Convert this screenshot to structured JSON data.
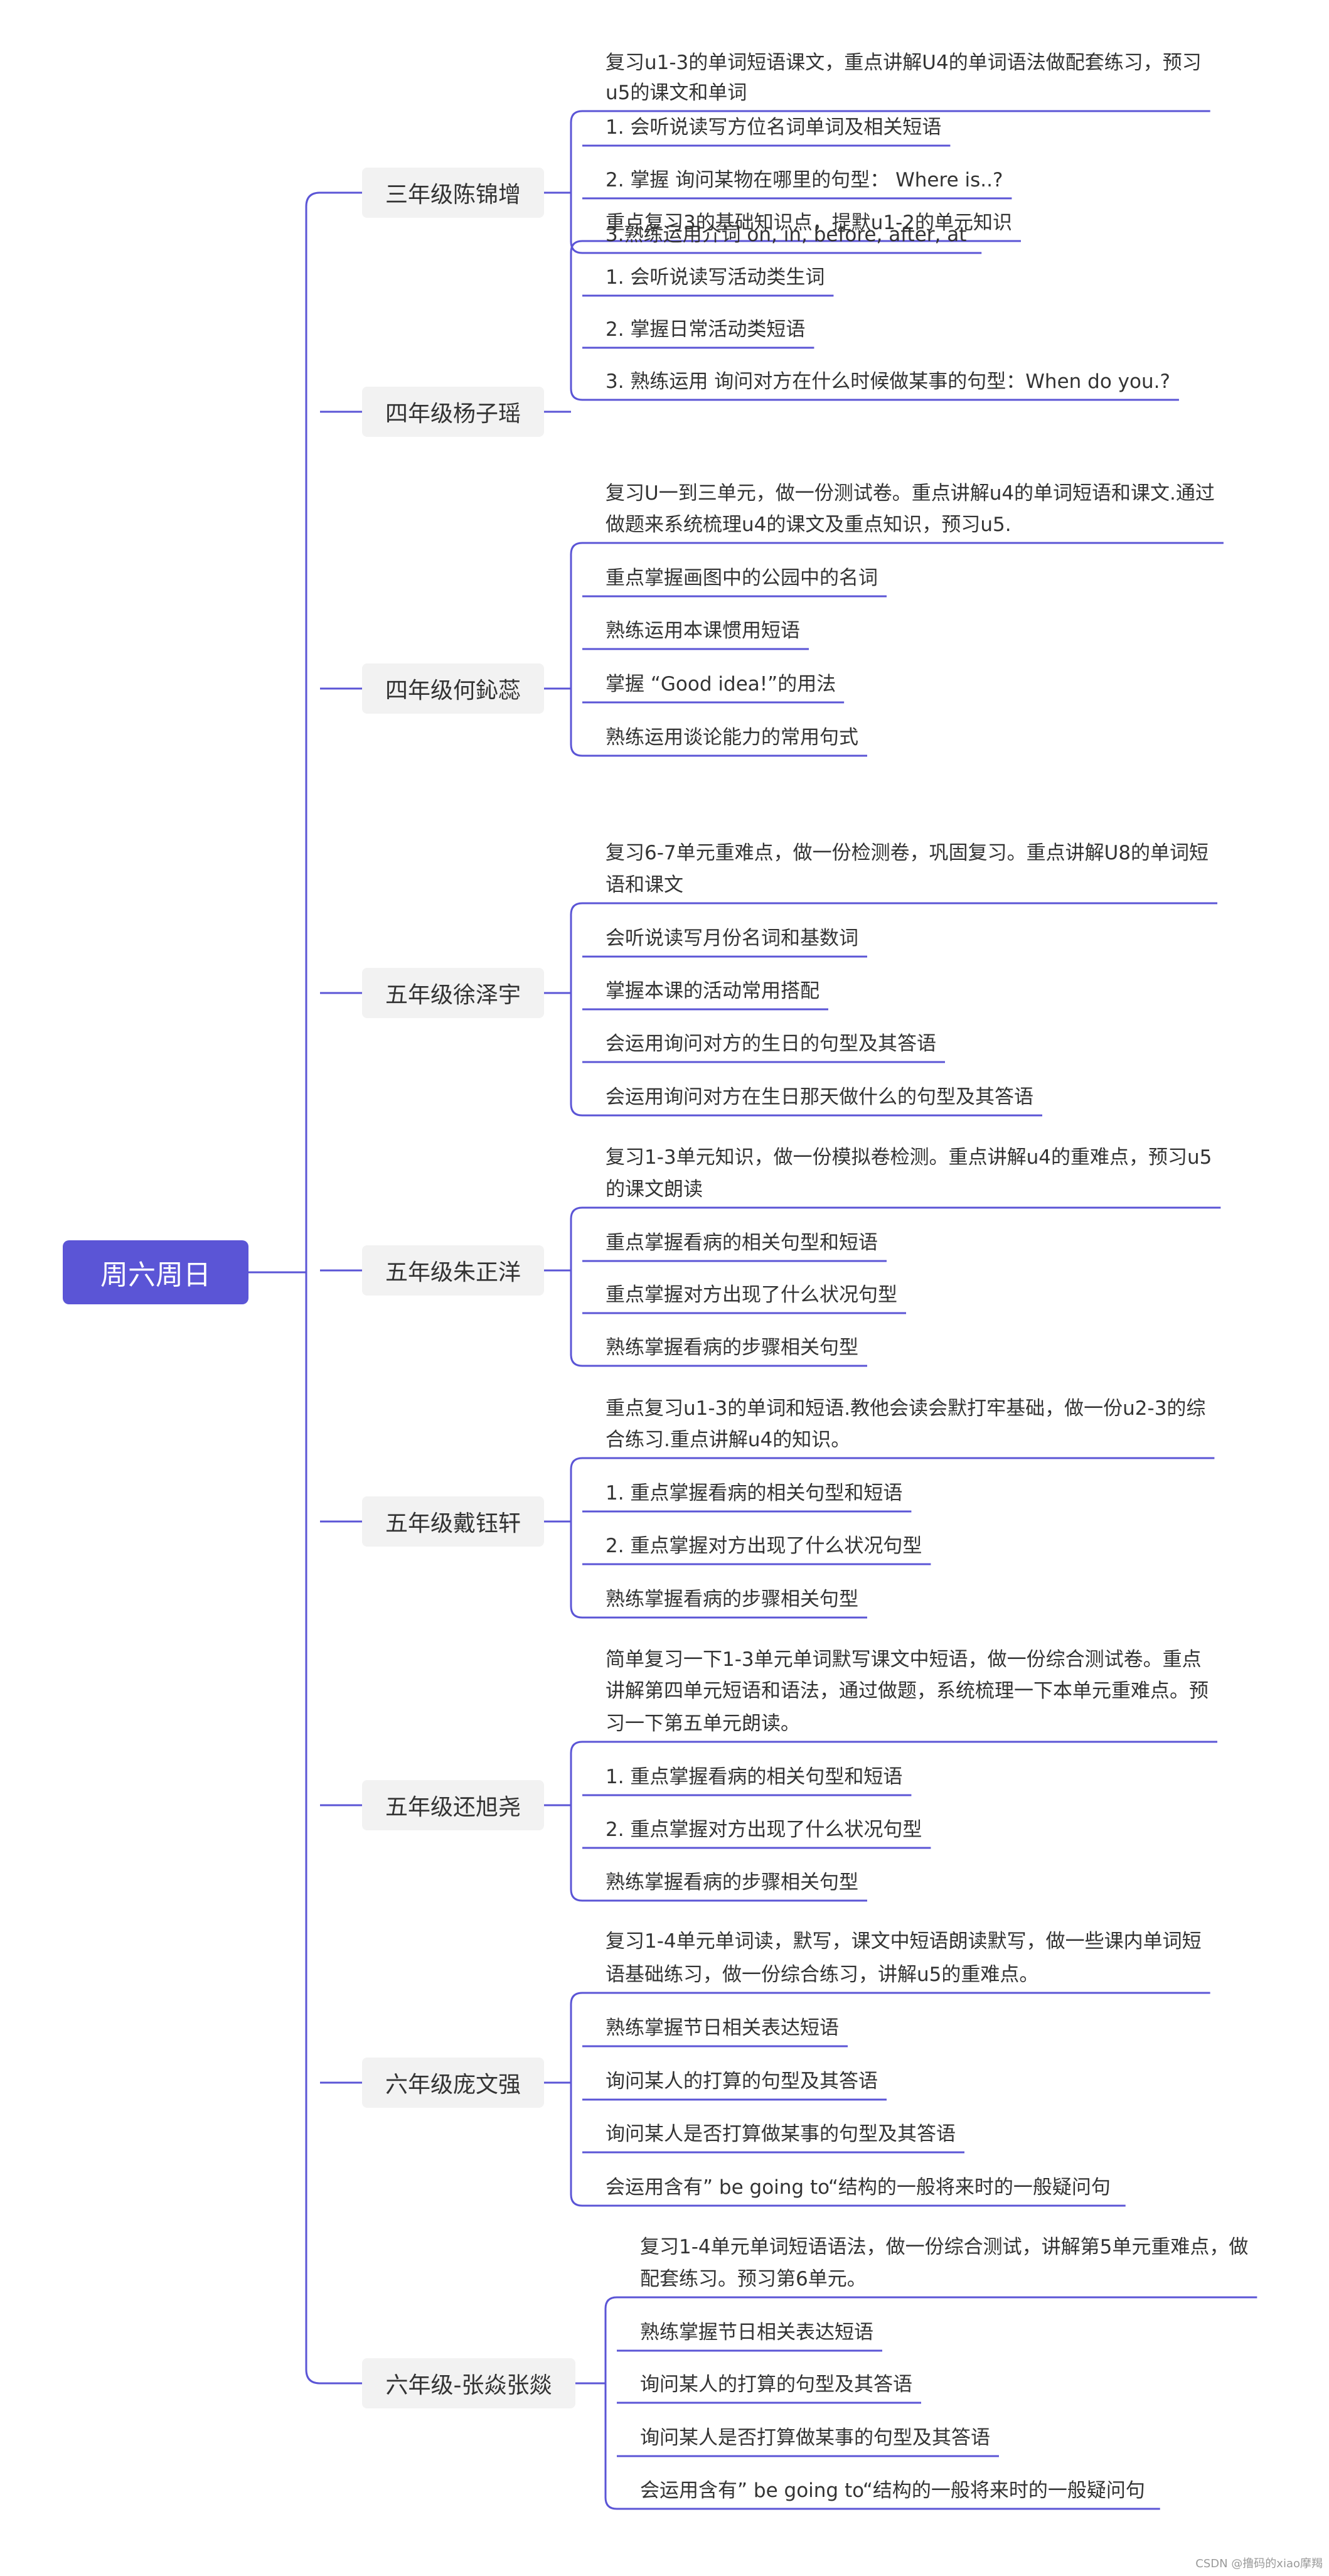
{
  "root": {
    "label": "周六周日"
  },
  "branches": [
    {
      "label": "三年级陈锦增",
      "leaves": [
        [
          "复习u1-3的单词短语课文，重点讲解U4的单词语法做配套练习，预习",
          "u5的课文和单词"
        ],
        [
          "1. 会听说读写方位名词单词及相关短语"
        ],
        [
          "2. 掌握 询问某物在哪里的句型： Where is..?"
        ],
        [
          "3.熟练运用介词  on, in, before, after, at"
        ]
      ]
    },
    {
      "label": "四年级杨子瑶",
      "leaves": [
        [
          "重点复习3的基础知识点，提默u1-2的单元知识"
        ],
        [
          "1. 会听说读写活动类生词"
        ],
        [
          "2. 掌握日常活动类短语"
        ],
        [
          "3. 熟练运用 询问对方在什么时候做某事的句型：When do you.?"
        ]
      ]
    },
    {
      "label": "四年级何鈊蕊",
      "leaves": [
        [
          "复习U一到三单元，做一份测试卷。重点讲解u4的单词短语和课文.通过",
          "做题来系统梳理u4的课文及重点知识，预习u5."
        ],
        [
          "重点掌握画图中的公园中的名词"
        ],
        [
          "熟练运用本课惯用短语"
        ],
        [
          "掌握 “Good idea!”的用法"
        ],
        [
          "熟练运用谈论能力的常用句式"
        ]
      ]
    },
    {
      "label": "五年级徐泽宇",
      "leaves": [
        [
          "复习6-7单元重难点，做一份检测卷，巩固复习。重点讲解U8的单词短",
          "语和课文"
        ],
        [
          "会听说读写月份名词和基数词"
        ],
        [
          "掌握本课的活动常用搭配"
        ],
        [
          "会运用询问对方的生日的句型及其答语"
        ],
        [
          "会运用询问对方在生日那天做什么的句型及其答语"
        ]
      ]
    },
    {
      "label": "五年级朱正洋",
      "leaves": [
        [
          "复习1-3单元知识，做一份模拟卷检测。重点讲解u4的重难点，预习u5",
          "的课文朗读"
        ],
        [
          "重点掌握看病的相关句型和短语"
        ],
        [
          "重点掌握对方出现了什么状况句型"
        ],
        [
          "熟练掌握看病的步骤相关句型"
        ]
      ]
    },
    {
      "label": "五年级戴钰轩",
      "leaves": [
        [
          "重点复习u1-3的单词和短语.教他会读会默打牢基础，做一份u2-3的综",
          "合练习.重点讲解u4的知识。"
        ],
        [
          "1. 重点掌握看病的相关句型和短语"
        ],
        [
          "2. 重点掌握对方出现了什么状况句型"
        ],
        [
          "熟练掌握看病的步骤相关句型"
        ]
      ]
    },
    {
      "label": "五年级还旭尧",
      "leaves": [
        [
          "简单复习一下1-3单元单词默写课文中短语，做一份综合测试卷。重点",
          "讲解第四单元短语和语法，通过做题，系统梳理一下本单元重难点。预",
          "习一下第五单元朗读。"
        ],
        [
          "1. 重点掌握看病的相关句型和短语"
        ],
        [
          "2. 重点掌握对方出现了什么状况句型"
        ],
        [
          "熟练掌握看病的步骤相关句型"
        ]
      ]
    },
    {
      "label": "六年级庞文强",
      "leaves": [
        [
          "复习1-4单元单词读，默写，课文中短语朗读默写，做一些课内单词短",
          "语基础练习，做一份综合练习，讲解u5的重难点。"
        ],
        [
          "熟练掌握节日相关表达短语"
        ],
        [
          "询问某人的打算的句型及其答语"
        ],
        [
          "询问某人是否打算做某事的句型及其答语"
        ],
        [
          "会运用含有”  be going to“结构的一般将来时的一般疑问句"
        ]
      ]
    },
    {
      "label": "六年级-张焱张燚",
      "leaves": [
        [
          "复习1-4单元单词短语语法，做一份综合测试，讲解第5单元重难点，做",
          "配套练习。预习第6单元。"
        ],
        [
          "熟练掌握节日相关表达短语"
        ],
        [
          "询问某人的打算的句型及其答语"
        ],
        [
          "询问某人是否打算做某事的句型及其答语"
        ],
        [
          "会运用含有”  be going to“结构的一般将来时的一般疑问句"
        ]
      ]
    }
  ],
  "watermark": "CSDN @撸码的xiao摩羯",
  "colors": {
    "line": "#5b55d6",
    "root_bg": "#5b55d6",
    "branch_bg": "#f2f2f2",
    "text": "#333333"
  }
}
